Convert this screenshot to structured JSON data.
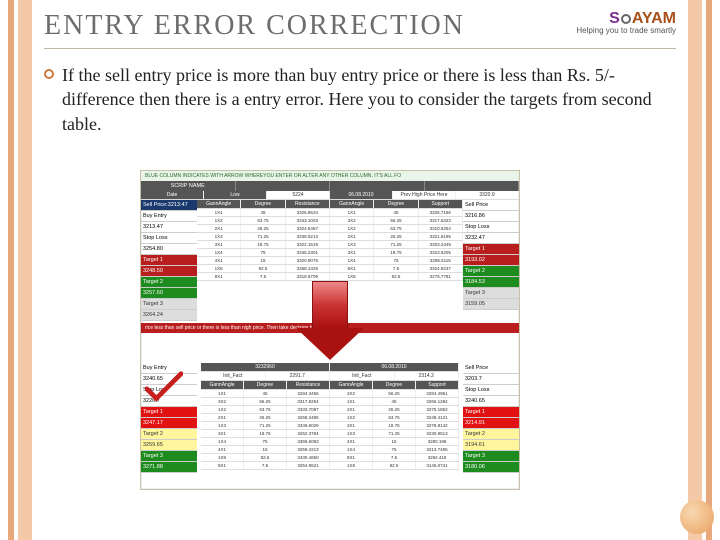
{
  "title": "ENTRY ERROR CORRECTION",
  "logo": {
    "brand_s": "S",
    "brand_rest": "AYAM",
    "tagline": "Helping you to trade smartly"
  },
  "paragraph": "If the sell entry price is more than buy entry price or there is less than Rs. 5/- difference then there is a entry error. Here you to consider the targets from second table.",
  "screenshot": {
    "topbar_left": "BLUE COLUMN INDICATES WITH ARROW WHEREYOU ENTER OR ALTER ANY OTHER COLUMN, IT'S ALL FO",
    "header_cells": [
      "SCRIP NAME",
      "",
      "",
      ""
    ],
    "date_row": {
      "date_label": "Date",
      "low_label": "Low",
      "low_val": "5224",
      "high_label": "",
      "midline": "06.08.2010",
      "ph_label": "Prev High Price Here",
      "ph_val": "3320.9"
    },
    "sub_hdr": [
      "GannAngle",
      "Degree",
      "Resistance",
      "GannAngle",
      "Degree",
      "Support"
    ],
    "top_table_rows": [
      [
        "1X1",
        "45",
        "3325.8634",
        "1X1",
        "45",
        "3325.7156"
      ],
      [
        "1X2",
        "63.75",
        "3343.1003",
        "3X2",
        "56.25",
        "3317.5323"
      ],
      [
        "2X1",
        "26.25",
        "3324.5467",
        "1X2",
        "63.75",
        "3310.6254"
      ],
      [
        "1X3",
        "71.25",
        "3338.5213",
        "2X1",
        "26.25",
        "3321.6195"
      ],
      [
        "3X1",
        "18.75",
        "3322.1519",
        "1X3",
        "71.25",
        "3303.2449"
      ],
      [
        "1X4",
        "75",
        "3345.2301",
        "3X1",
        "18.75",
        "3323.5205"
      ],
      [
        "4X1",
        "15",
        "3320.9075",
        "1X4",
        "75",
        "3295.5115"
      ],
      [
        "1X8",
        "82.5",
        "3358.1325",
        "8X1",
        "7.5",
        "3324.8237"
      ],
      [
        "8X1",
        "7.5",
        "3318.6709",
        "1X8",
        "82.5",
        "3279.7781"
      ]
    ],
    "left_labels": [
      {
        "cls": "bg-darkblue",
        "txt": "Sell Price:3213:47"
      },
      {
        "cls": "",
        "txt": "Buy Entry"
      },
      {
        "cls": "",
        "txt": "3213.47"
      },
      {
        "cls": "",
        "txt": "Stop Loss"
      },
      {
        "cls": "",
        "txt": "3254.80"
      },
      {
        "cls": "bg-red",
        "txt": "Target 1"
      },
      {
        "cls": "bg-red",
        "txt": "3248.50"
      },
      {
        "cls": "bg-green",
        "txt": "Target 2"
      },
      {
        "cls": "bg-green",
        "txt": "3257.60"
      },
      {
        "cls": "bg-gray",
        "txt": "Target 3"
      },
      {
        "cls": "bg-gray",
        "txt": "3264.24"
      }
    ],
    "right_labels": [
      {
        "cls": "",
        "txt": "Sell Price"
      },
      {
        "cls": "",
        "txt": "3216.86"
      },
      {
        "cls": "",
        "txt": "Stop Loss"
      },
      {
        "cls": "",
        "txt": "3232.47"
      },
      {
        "cls": "bg-red",
        "txt": "Target 1"
      },
      {
        "cls": "bg-red",
        "txt": "3193.02"
      },
      {
        "cls": "bg-green",
        "txt": "Target 2"
      },
      {
        "cls": "bg-green",
        "txt": "3184.53"
      },
      {
        "cls": "bg-gray",
        "txt": "Target 3"
      },
      {
        "cls": "bg-gray",
        "txt": "3159.05"
      }
    ],
    "warn_text": "rice less than sell price or there is less than                              nigh price. Then take decision based o",
    "bottom_hdr_l": "3232960",
    "bottom_hdr_r": "06.08.2010",
    "bottom_sub_l": "Init_Fact",
    "bottom_sub_l2": "2291.7",
    "bottom_sub_r": "Init_Fact",
    "bottom_sub_r2": "2314.2",
    "bottom_table_rows": [
      [
        "1X1",
        "45",
        "3284.3456",
        "3X2",
        "56.25",
        "3284.4961"
      ],
      [
        "3X2",
        "56.25",
        "3317.9254",
        "1X1",
        "45",
        "3266.1284"
      ],
      [
        "1X2",
        "63.75",
        "3333.7087",
        "2X1",
        "26.25",
        "3275.1852"
      ],
      [
        "2X1",
        "26.25",
        "3268.2485",
        "1X2",
        "63.75",
        "3248.4121"
      ],
      [
        "1X3",
        "71.25",
        "3349.6029",
        "3X1",
        "18.75",
        "3278.8142"
      ],
      [
        "3X1",
        "18.75",
        "3262.3784",
        "1X3",
        "71.25",
        "3230.9513"
      ],
      [
        "1X4",
        "75",
        "3365.6083",
        "4X1",
        "15",
        "3280.198"
      ],
      [
        "4X1",
        "15",
        "3259.4213",
        "1X4",
        "75",
        "3213.7485"
      ],
      [
        "1X8",
        "82.5",
        "3430.4650",
        "8X1",
        "7.5",
        "3282.418"
      ],
      [
        "8X1",
        "7.5",
        "3254.9521",
        "1X8",
        "82.5",
        "3146.0741"
      ]
    ],
    "left_labels_b": [
      {
        "cls": "",
        "txt": "Buy Entry"
      },
      {
        "cls": "",
        "txt": "3240.65"
      },
      {
        "cls": "",
        "txt": "Stop Loss"
      },
      {
        "cls": "",
        "txt": "3226.7"
      },
      {
        "cls": "bg-brightred",
        "txt": "Target 1"
      },
      {
        "cls": "bg-brightred",
        "txt": "3247.17"
      },
      {
        "cls": "bg-yellow",
        "txt": "Target 2"
      },
      {
        "cls": "bg-yellow",
        "txt": "3259.65"
      },
      {
        "cls": "bg-green",
        "txt": "Target 3"
      },
      {
        "cls": "bg-green",
        "txt": "3271.88"
      }
    ],
    "right_labels_b": [
      {
        "cls": "",
        "txt": "Sell Price"
      },
      {
        "cls": "",
        "txt": "3203.7"
      },
      {
        "cls": "",
        "txt": "Stop Loss"
      },
      {
        "cls": "",
        "txt": "3240.65"
      },
      {
        "cls": "bg-brightred",
        "txt": "Target 1"
      },
      {
        "cls": "bg-brightred",
        "txt": "3214.91"
      },
      {
        "cls": "bg-yellow",
        "txt": "Target 2"
      },
      {
        "cls": "bg-yellow",
        "txt": "3194.61"
      },
      {
        "cls": "bg-green",
        "txt": "Target 3"
      },
      {
        "cls": "bg-green",
        "txt": "3180.06"
      }
    ]
  }
}
